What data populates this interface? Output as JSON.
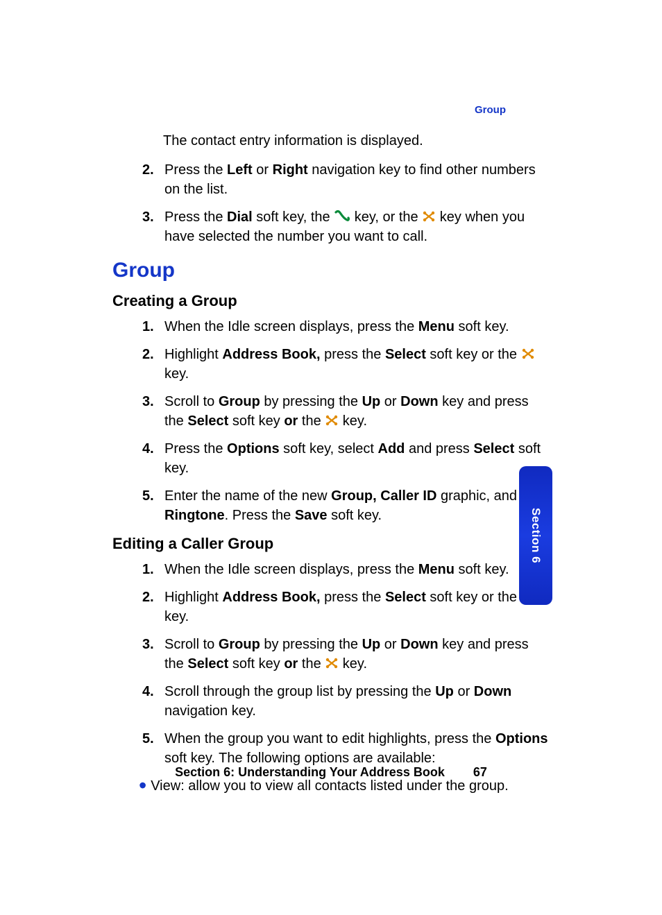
{
  "header_label": "Group",
  "intro": "The contact entry information is displayed.",
  "top_steps": [
    {
      "n": "2.",
      "parts": [
        "Press the ",
        {
          "b": "Left"
        },
        " or ",
        {
          "b": "Right"
        },
        " navigation key to find other numbers on the list."
      ]
    },
    {
      "n": "3.",
      "parts": [
        "Press the ",
        {
          "b": "Dial"
        },
        " soft key, the ",
        {
          "icon": "phone"
        },
        " key, or the ",
        {
          "icon": "x"
        },
        " key when you have selected the number you want to call."
      ]
    }
  ],
  "section_heading": "Group",
  "sub1": "Creating a Group",
  "creating_steps": [
    {
      "n": "1.",
      "parts": [
        "When the Idle screen displays, press the ",
        {
          "b": "Menu"
        },
        " soft key."
      ]
    },
    {
      "n": "2.",
      "parts": [
        "Highlight ",
        {
          "b": "Address Book,"
        },
        " press the ",
        {
          "b": "Select"
        },
        " soft key or the ",
        {
          "icon": "x"
        },
        " key."
      ]
    },
    {
      "n": "3.",
      "parts": [
        "Scroll to ",
        {
          "b": "Group"
        },
        " by pressing the ",
        {
          "b": "Up"
        },
        " or ",
        {
          "b": "Down"
        },
        " key and press the ",
        {
          "b": "Select"
        },
        " soft key ",
        {
          "b": "or"
        },
        " the ",
        {
          "icon": "x"
        },
        " key."
      ]
    },
    {
      "n": "4.",
      "parts": [
        "Press the ",
        {
          "b": "Options"
        },
        " soft key, select ",
        {
          "b": "Add"
        },
        " and press ",
        {
          "b": "Select"
        },
        " soft key."
      ]
    },
    {
      "n": "5.",
      "parts": [
        "Enter the name of the new ",
        {
          "b": "Group, Caller ID"
        },
        " graphic, and ",
        {
          "b": "Ringtone"
        },
        ". Press the ",
        {
          "b": "Save"
        },
        " soft key."
      ]
    }
  ],
  "sub2": "Editing a Caller Group",
  "editing_steps": [
    {
      "n": "1.",
      "parts": [
        "When the Idle screen displays, press the ",
        {
          "b": "Menu"
        },
        " soft key."
      ]
    },
    {
      "n": "2.",
      "parts": [
        "Highlight ",
        {
          "b": "Address Book,"
        },
        " press the ",
        {
          "b": "Select"
        },
        " soft key or the ",
        {
          "icon": "x"
        },
        " key."
      ]
    },
    {
      "n": "3.",
      "parts": [
        "Scroll to ",
        {
          "b": "Group"
        },
        " by pressing the ",
        {
          "b": "Up"
        },
        " or ",
        {
          "b": "Down"
        },
        " key and press the ",
        {
          "b": "Select"
        },
        " soft key ",
        {
          "b": "or"
        },
        " the ",
        {
          "icon": "x"
        },
        " key."
      ]
    },
    {
      "n": "4.",
      "parts": [
        "Scroll through the group list by pressing the ",
        {
          "b": "Up"
        },
        " or ",
        {
          "b": "Down"
        },
        " navigation key."
      ]
    },
    {
      "n": "5.",
      "parts": [
        "When the group you want to edit highlights, press the ",
        {
          "b": "Options"
        },
        " soft key. The following options are available:"
      ]
    }
  ],
  "bullet": "View: allow you to view all contacts listed under the group.",
  "footer_text": "Section 6: Understanding Your Address Book",
  "footer_page": "67",
  "side_tab": "Section 6",
  "icons": {
    "phone": "phone-icon",
    "x": "x-key-icon"
  },
  "colors": {
    "accent": "#1436c8"
  }
}
